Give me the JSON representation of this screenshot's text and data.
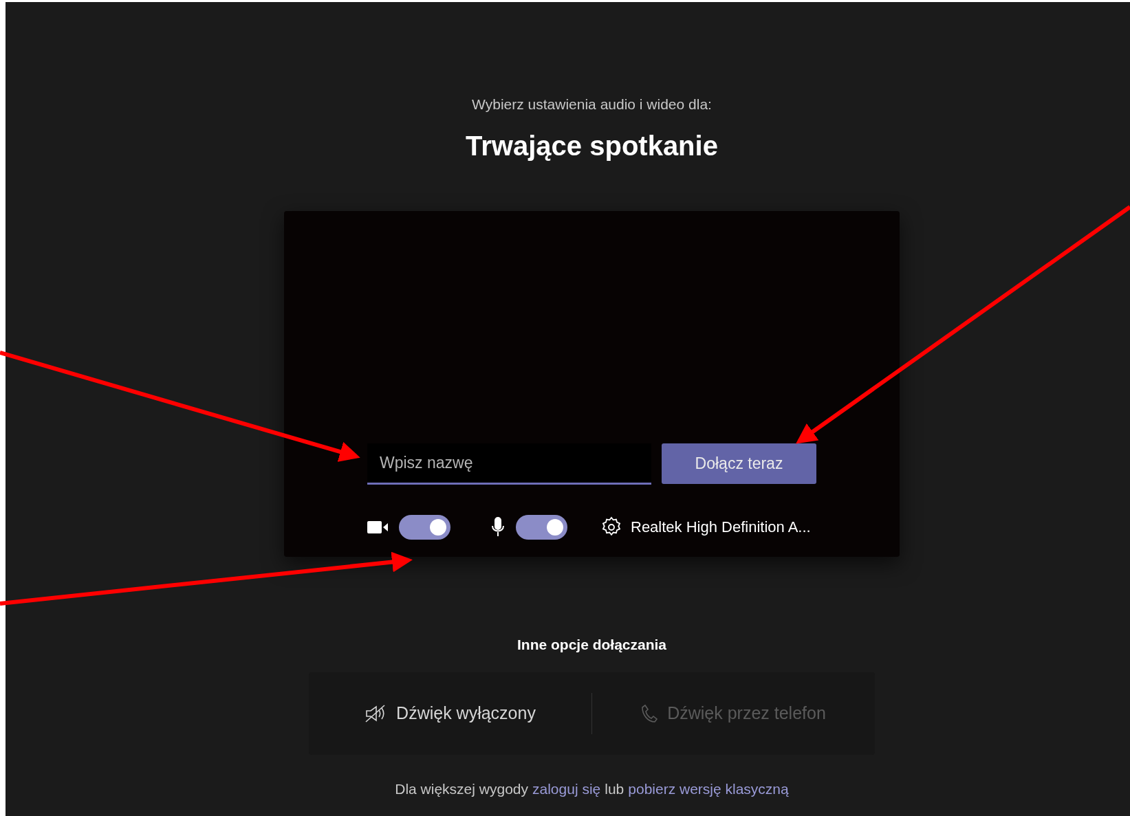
{
  "header": {
    "subtitle": "Wybierz ustawienia audio i wideo dla:",
    "title": "Trwające spotkanie"
  },
  "name_field": {
    "placeholder": "Wpisz nazwę"
  },
  "join_button": {
    "label": "Dołącz teraz"
  },
  "camera_toggle": {
    "on": true
  },
  "mic_toggle": {
    "on": true
  },
  "device": {
    "label": "Realtek High Definition A..."
  },
  "other_options": {
    "heading": "Inne opcje dołączania",
    "items": [
      {
        "kind": "audio-off",
        "label": "Dźwięk wyłączony",
        "disabled": false
      },
      {
        "kind": "phone",
        "label": "Dźwięk przez telefon",
        "disabled": true
      }
    ]
  },
  "footer": {
    "text": "Dla większej wygody",
    "link_1": "zaloguj się",
    "middle": "lub",
    "link_2": "pobierz wersję klasyczną"
  }
}
